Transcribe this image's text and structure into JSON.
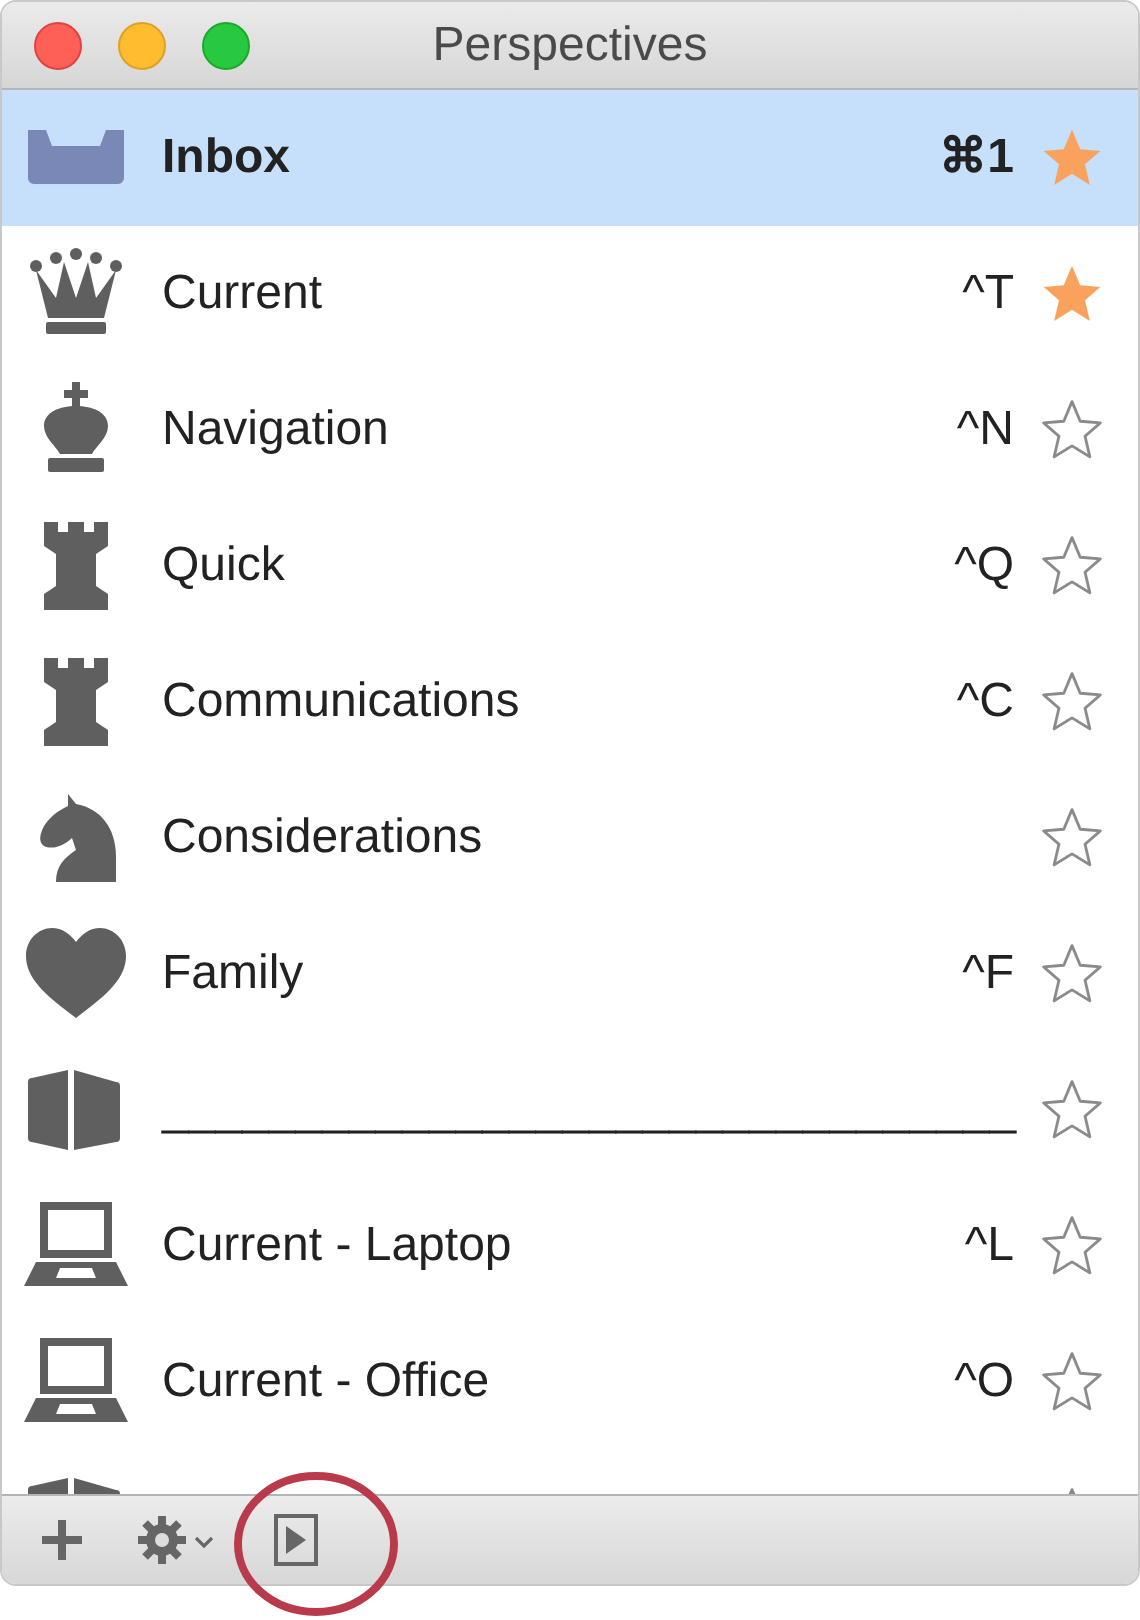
{
  "window": {
    "title": "Perspectives"
  },
  "rows": [
    {
      "kind": "inbox",
      "label": "Inbox",
      "shortcut": "⌘1",
      "starred": true,
      "selected": true
    },
    {
      "kind": "queen",
      "label": "Current",
      "shortcut": "^T",
      "starred": true,
      "selected": false
    },
    {
      "kind": "king",
      "label": "Navigation",
      "shortcut": "^N",
      "starred": false,
      "selected": false
    },
    {
      "kind": "rook",
      "label": "Quick",
      "shortcut": "^Q",
      "starred": false,
      "selected": false
    },
    {
      "kind": "rook",
      "label": "Communications",
      "shortcut": "^C",
      "starred": false,
      "selected": false
    },
    {
      "kind": "knight",
      "label": "Considerations",
      "starred": false,
      "selected": false
    },
    {
      "kind": "heart",
      "label": "Family",
      "shortcut": "^F",
      "starred": false,
      "selected": false
    },
    {
      "kind": "book",
      "label": "________________________________",
      "starred": false,
      "selected": false
    },
    {
      "kind": "laptop",
      "label": "Current - Laptop",
      "shortcut": "^L",
      "starred": false,
      "selected": false
    },
    {
      "kind": "laptop",
      "label": "Current - Office",
      "shortcut": "^O",
      "starred": false,
      "selected": false
    },
    {
      "kind": "book",
      "starred": false,
      "selected": false
    }
  ]
}
